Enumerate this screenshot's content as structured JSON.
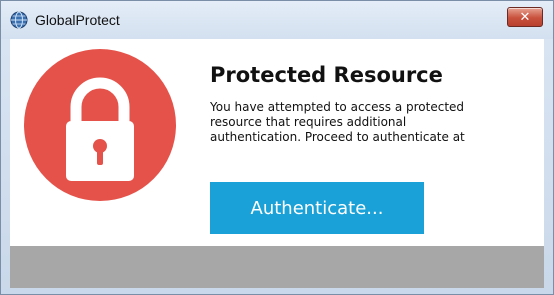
{
  "window": {
    "title": "GlobalProtect",
    "close_glyph": "✕",
    "app_icon": "globe-icon"
  },
  "main": {
    "lock_icon": "lock-icon",
    "lock_color": "#e5524a",
    "heading": "Protected Resource",
    "message_lines": [
      "You have attempted to access a protected",
      "resource that requires additional",
      "authentication. Proceed to authenticate at"
    ],
    "authenticate_label": "Authenticate...",
    "button_color": "#1aa2d8"
  }
}
